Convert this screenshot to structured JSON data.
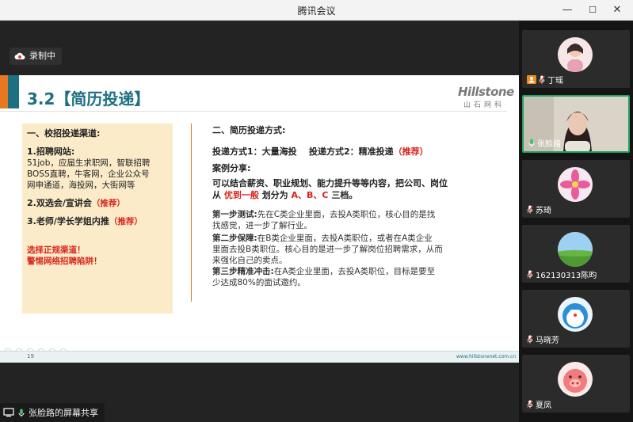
{
  "window": {
    "title": "腾讯会议",
    "min": "—",
    "max": "☐",
    "close": "✕"
  },
  "recording": {
    "label": "录制中"
  },
  "slide": {
    "title": "3.2【简历投递】",
    "logo_en": "Hillstone",
    "logo_cn": "山石网科",
    "left": {
      "heading": "一、校招投递渠道:",
      "item1_title": "1.招聘网站:",
      "item1_body1": "51job，应届生求职网，智联招聘",
      "item1_body2": "BOSS直聘，牛客网，企业公众号",
      "item1_body3": "网申通道，海投网，大街网等",
      "item2": "2.双选会/宣讲会",
      "item2_tag": "（推荐）",
      "item3": "3.老师/学长学姐内推",
      "item3_tag": "（推荐）",
      "warn1": "选择正规渠道！",
      "warn2": "警惕网络招聘陷阱！"
    },
    "right": {
      "heading": "二、简历投递方式:",
      "methods_a": "投递方式1：大量海投",
      "methods_b": "投递方式2：精准投递",
      "methods_tag": "（推荐）",
      "case_title": "案例分享:",
      "case_line1": "可以结合薪资、职业规划、能力提升等等内容，把公司、岗位",
      "case_line2a": "从",
      "case_line2b": "优到一般",
      "case_line2c": "划分为",
      "case_line2d": "A、B、C",
      "case_line2e": "三档。",
      "step1_label": "第一步测试:",
      "step1_a": "先在C类企业里面，去投A类职位，核心目的是找",
      "step1_b": "找感觉，进一步了解行业。",
      "step2_label": "第二步保障:",
      "step2_a": "在B类企业里面，去投A类职位，或者在A类企业",
      "step2_b": "里面去投B类职位。核心目的是进一步了解岗位招聘需求，从而",
      "step2_c": "来强化自己的卖点。",
      "step3_label": "第三步精准冲击:",
      "step3_a": "在A类企业里面，去投A类职位，目标是要至",
      "step3_b": "少达成80%的面试邀约。"
    },
    "page_number": "19",
    "footer_url": "www.hillstonenet.com.cn"
  },
  "share": {
    "label": "张脸路的屏幕共享"
  },
  "participants": [
    {
      "name": "丁瑶",
      "badge": "host"
    },
    {
      "name": "张脸路",
      "badge": "active"
    },
    {
      "name": "苏琦"
    },
    {
      "name": "162130313陈昀"
    },
    {
      "name": "马晓芳"
    },
    {
      "name": "夏凤"
    }
  ],
  "colors": {
    "accent_teal": "#1d6f82",
    "accent_orange": "#e87722",
    "red": "#d9251d",
    "active_green": "#23a15b"
  }
}
